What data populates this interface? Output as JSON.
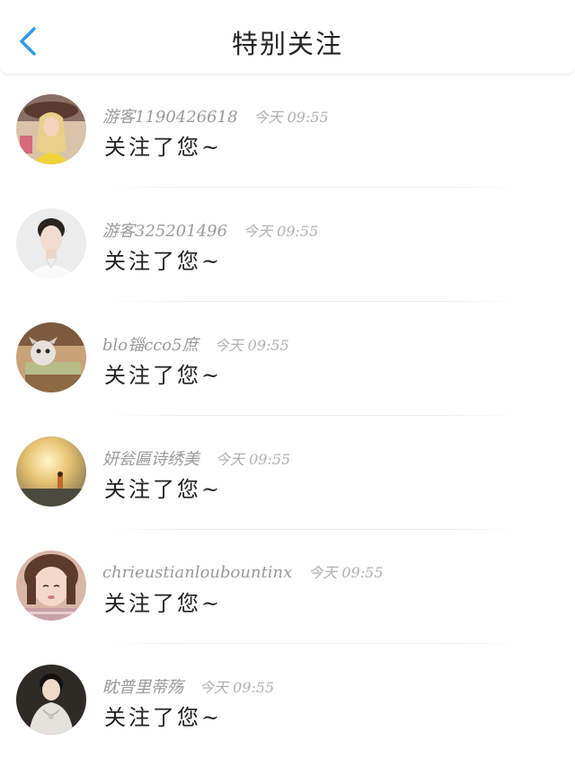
{
  "header": {
    "back_icon": "chevron-left-icon",
    "title": "特别关注",
    "accent": "#2f9be8"
  },
  "notifications": [
    {
      "username": "游客1190426618",
      "time": "今天 09:55",
      "message": "关注了您~"
    },
    {
      "username": "游客325201496",
      "time": "今天 09:55",
      "message": "关注了您~"
    },
    {
      "username": "blo锱cco5庶",
      "time": "今天 09:55",
      "message": "关注了您~"
    },
    {
      "username": "妍瓮匾诗绣美",
      "time": "今天 09:55",
      "message": "关注了您~"
    },
    {
      "username": "chrieustianloubountinx",
      "time": "今天 09:55",
      "message": "关注了您~"
    },
    {
      "username": "眈普里蒂殇",
      "time": "今天 09:55",
      "message": "关注了您~"
    }
  ]
}
